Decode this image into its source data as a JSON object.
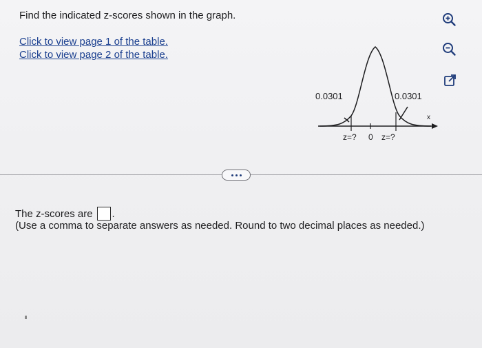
{
  "question": {
    "prompt": "Find the indicated z-scores shown in the graph."
  },
  "links": [
    {
      "label": "Click to view page 1 of the table."
    },
    {
      "label": "Click to view page 2 of the table."
    }
  ],
  "tools": {
    "zoom_in": "zoom-in-icon",
    "zoom_out": "zoom-out-icon",
    "open_external": "external-link-icon"
  },
  "graph": {
    "left_area": "0.0301",
    "right_area": "0.0301",
    "left_z": "z=?",
    "center": "0",
    "right_z": "z=?",
    "axis_label": "x"
  },
  "answer": {
    "prefix": "The z-scores are",
    "suffix": ".",
    "instruction": "(Use a comma to separate answers as needed. Round to two decimal places as needed.)"
  },
  "colors": {
    "link": "#1a3f8f",
    "accent": "#1e3b7a"
  }
}
